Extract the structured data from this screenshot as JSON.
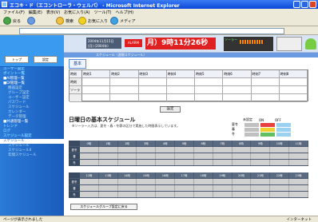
{
  "window": {
    "title": "エコキ・ド（エコントローラ・ウェルバ） - Microsoft Internet Explorer"
  },
  "menu": [
    "ファイル(F)",
    "編集(E)",
    "表示(V)",
    "お気に入り(A)",
    "ツール(T)",
    "ヘルプ(H)"
  ],
  "toolbar": {
    "back": "戻る",
    "search": "検索",
    "favorites": "お気に入り",
    "media": "メディア"
  },
  "header": {
    "date": "2004年11月15日 (月) (2004年)",
    "badge": "ALARM",
    "clock": "月）9時11分26秒",
    "status_label": "ソーラー"
  },
  "sidebar": {
    "buttons": [
      "トップ",
      "設定"
    ],
    "items": [
      {
        "label": "ユーザー設定",
        "kind": "group"
      },
      {
        "label": "ポイント一覧",
        "kind": "group"
      },
      {
        "label": "■AI管理一覧",
        "kind": "item"
      },
      {
        "label": "■DI管理一覧",
        "kind": "item"
      },
      {
        "label": "機器設定",
        "kind": "sub"
      },
      {
        "label": "グループ設定",
        "kind": "sub"
      },
      {
        "label": "ユーザー設定",
        "kind": "sub"
      },
      {
        "label": "パスワード",
        "kind": "sub"
      },
      {
        "label": "スケジュール",
        "kind": "sub"
      },
      {
        "label": "カレンダー",
        "kind": "sub"
      },
      {
        "label": "データ管理",
        "kind": "sub"
      },
      {
        "label": "■共通管理一覧",
        "kind": "item"
      },
      {
        "label": "トレンド",
        "kind": "group"
      },
      {
        "label": "ログ",
        "kind": "group"
      },
      {
        "label": "スケジュール設定",
        "kind": "group"
      },
      {
        "label": "スケジュール",
        "kind": "sel"
      },
      {
        "label": "スケジュール",
        "kind": "sub"
      },
      {
        "label": "スケジュールII",
        "kind": "sub"
      },
      {
        "label": "年間スケジュール",
        "kind": "sub"
      }
    ]
  },
  "main": {
    "tab_strip": "スケジュール（週間スケジュール）",
    "kihon_label": "基本",
    "grid_headers": [
      "時刻",
      "時刻1",
      "時刻2",
      "時刻3",
      "時刻4",
      "時刻5",
      "時刻6",
      "時刻7",
      "時刻8"
    ],
    "grid_rows": [
      "時刻",
      "ソーラー"
    ],
    "set_button": "設定",
    "section_title": "日曜日の基本スケジュール",
    "note": "※ソーラー入力は、夏冬・春・冬節の区分で実施した時間表示しています。",
    "legend": {
      "headers": [
        "未設定",
        "ON",
        "OFF"
      ],
      "rows": [
        "夏冬",
        "春",
        "冬"
      ]
    },
    "day_rows_top": [
      "0時",
      "1時",
      "2時",
      "3時",
      "4時",
      "5時",
      "6時",
      "7時",
      "8時",
      "9時",
      "10時",
      "11時"
    ],
    "day_rows_bottom": [
      "12時",
      "13時",
      "14時",
      "15時",
      "16時",
      "17時",
      "18時",
      "19時",
      "20時",
      "21時",
      "22時",
      "23時"
    ],
    "day_labels": [
      "夏冬",
      "春",
      "冬"
    ],
    "bottom_button": "スケジュールグループ設定に戻る"
  },
  "statusbar": {
    "left": "ページが表示されました",
    "right": "インターネット"
  },
  "colors": {
    "accent": "#1a5cbc",
    "alarm": "#e02020",
    "grid": "#5a6a80"
  }
}
